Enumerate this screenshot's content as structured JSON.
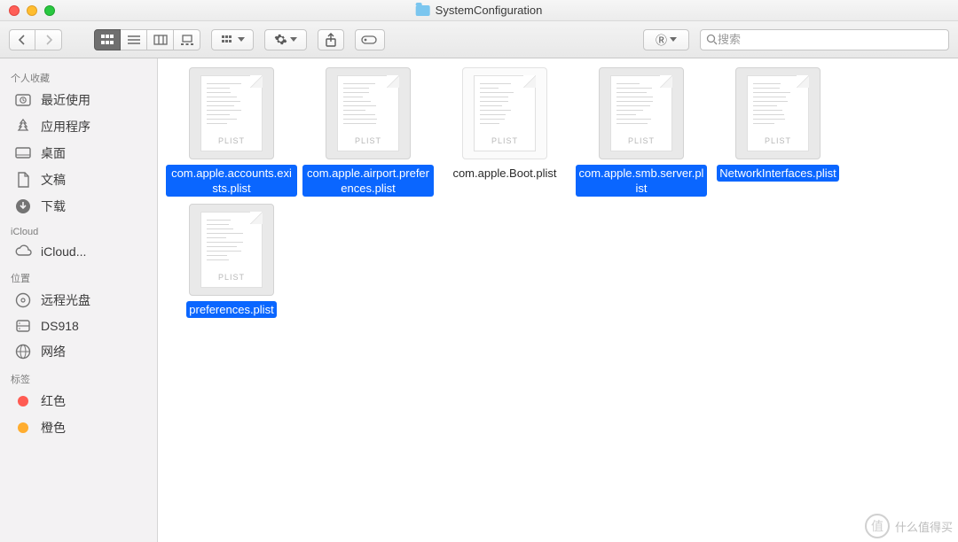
{
  "window": {
    "title": "SystemConfiguration"
  },
  "search": {
    "placeholder": "搜索"
  },
  "toolbar": {
    "dropdown_glyph": "Ⓡ"
  },
  "sidebar": {
    "sections": [
      {
        "heading": "个人收藏",
        "items": [
          {
            "icon": "clock",
            "label": "最近使用"
          },
          {
            "icon": "apps",
            "label": "应用程序"
          },
          {
            "icon": "desktop",
            "label": "桌面"
          },
          {
            "icon": "doc",
            "label": "文稿"
          },
          {
            "icon": "download",
            "label": "下载"
          }
        ]
      },
      {
        "heading": "iCloud",
        "items": [
          {
            "icon": "cloud",
            "label": "iCloud..."
          }
        ]
      },
      {
        "heading": "位置",
        "items": [
          {
            "icon": "disc",
            "label": "远程光盘"
          },
          {
            "icon": "drive",
            "label": "DS918"
          },
          {
            "icon": "network",
            "label": "网络"
          }
        ]
      },
      {
        "heading": "标签",
        "items": [
          {
            "icon": "tag",
            "color": "#ff5b52",
            "label": "红色"
          },
          {
            "icon": "tag",
            "color": "#ffad2f",
            "label": "橙色"
          }
        ]
      }
    ]
  },
  "files": [
    {
      "name": "com.apple.accounts.exists.plist",
      "type": "PLIST",
      "selected": true
    },
    {
      "name": "com.apple.airport.preferences.plist",
      "type": "PLIST",
      "selected": true
    },
    {
      "name": "com.apple.Boot.plist",
      "type": "PLIST",
      "selected": false
    },
    {
      "name": "com.apple.smb.server.plist",
      "type": "PLIST",
      "selected": true
    },
    {
      "name": "NetworkInterfaces.plist",
      "type": "PLIST",
      "selected": true
    },
    {
      "name": "preferences.plist",
      "type": "PLIST",
      "selected": true
    }
  ],
  "watermark": {
    "badge": "值",
    "text": "什么值得买"
  }
}
